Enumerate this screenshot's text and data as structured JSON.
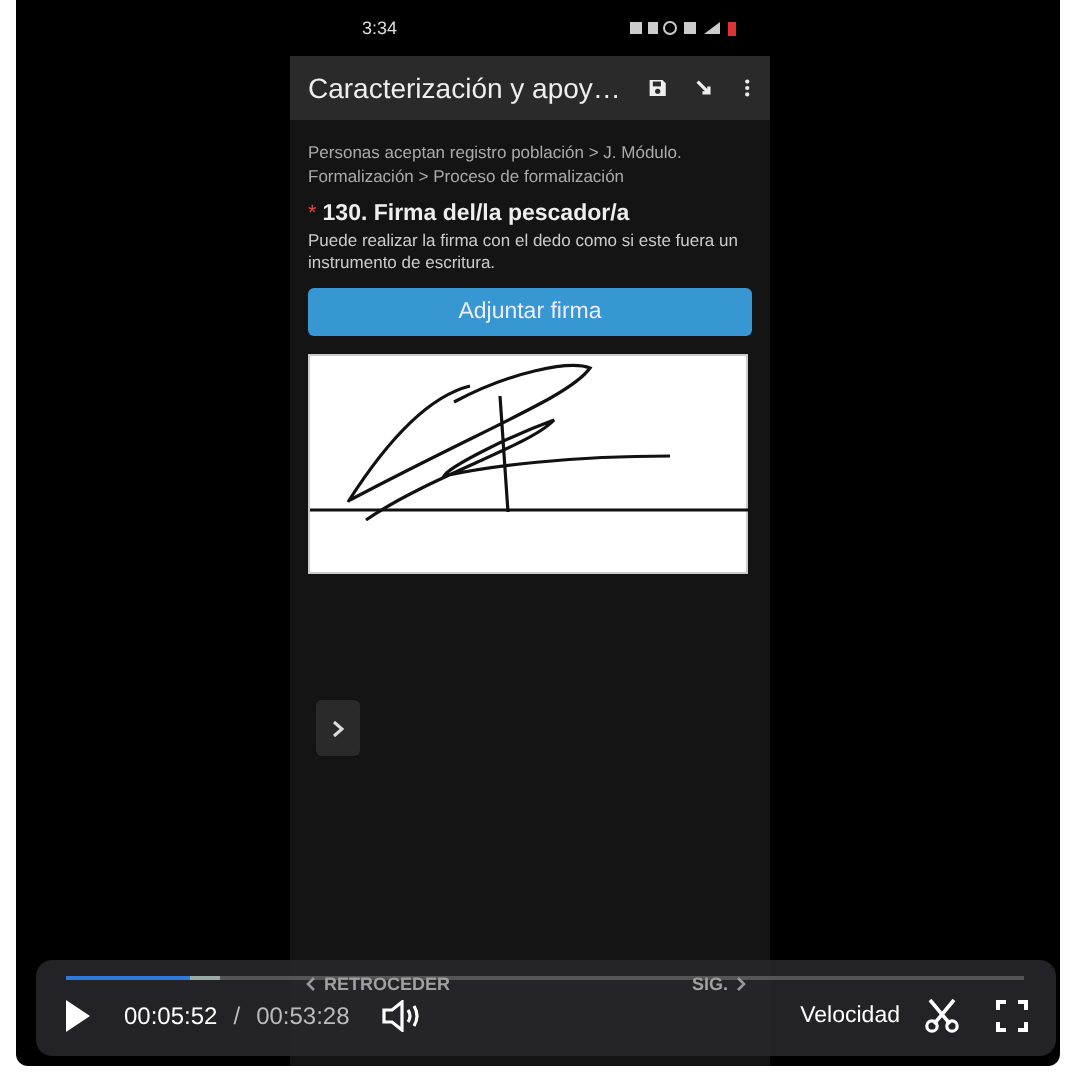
{
  "video_frame": {
    "status_bar": {
      "time": "3:34"
    },
    "app_bar": {
      "title": "Caracterización y apoy…"
    },
    "breadcrumb": "Personas aceptan registro población > J. Módulo. Formalización > Proceso de formalización",
    "question": {
      "required_mark": "*",
      "title": "130. Firma del/la pescador/a",
      "hint": "Puede realizar la firma con el dedo como si este fuera un instrumento de escritura."
    },
    "attach_button": "Adjuntar firma",
    "nav": {
      "back": "RETROCEDER",
      "next": "SIG."
    }
  },
  "player": {
    "playing": false,
    "level": 0.13,
    "current_time": "00:05:52",
    "separator": "/",
    "duration": "00:53:28",
    "speed_label": "Velocidad"
  }
}
